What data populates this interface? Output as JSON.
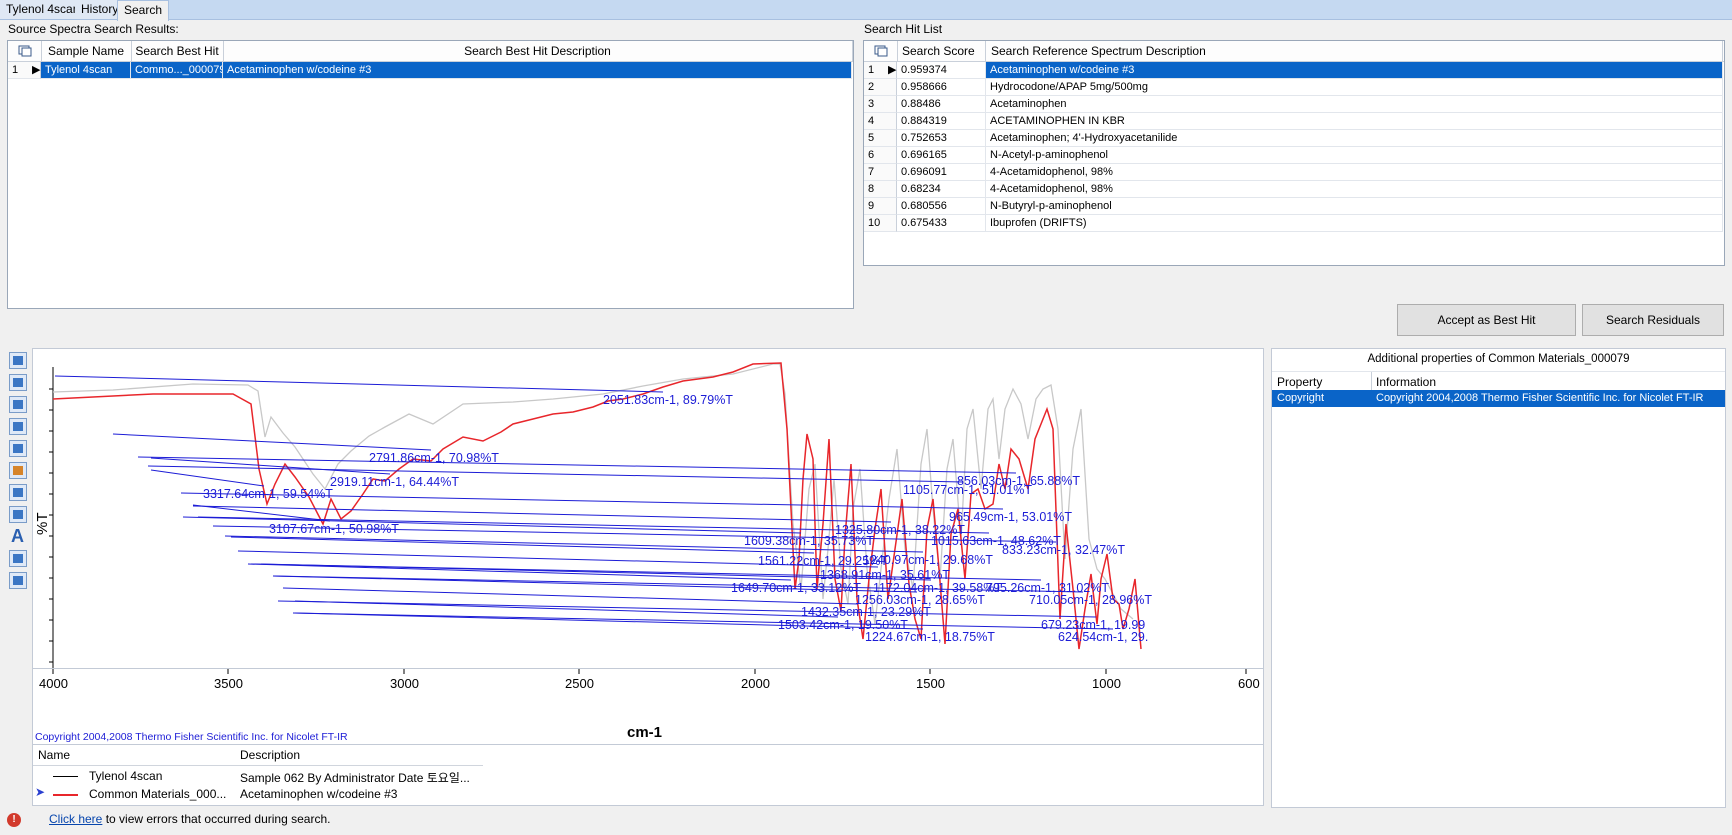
{
  "tabs": [
    "Tylenol 4scan",
    "History",
    "Search"
  ],
  "source_panel": {
    "label": "Source Spectra Search Results:",
    "columns": [
      "Sample Name",
      "Search Best Hit",
      "Search Best Hit Description"
    ],
    "rows": [
      {
        "num": "1",
        "name": "Tylenol 4scan",
        "hit": "Commo..._000079",
        "desc": "Acetaminophen w/codeine #3"
      }
    ]
  },
  "hit_panel": {
    "label": "Search Hit List",
    "columns": [
      "Search Score",
      "Search Reference Spectrum Description"
    ],
    "rows": [
      {
        "num": "1",
        "score": "0.959374",
        "desc": "Acetaminophen w/codeine #3"
      },
      {
        "num": "2",
        "score": "0.958666",
        "desc": "Hydrocodone/APAP 5mg/500mg"
      },
      {
        "num": "3",
        "score": "0.88486",
        "desc": "Acetaminophen"
      },
      {
        "num": "4",
        "score": "0.884319",
        "desc": "ACETAMINOPHEN IN KBR"
      },
      {
        "num": "5",
        "score": "0.752653",
        "desc": "Acetaminophen; 4'-Hydroxyacetanilide"
      },
      {
        "num": "6",
        "score": "0.696165",
        "desc": "N-Acetyl-p-aminophenol"
      },
      {
        "num": "7",
        "score": "0.696091",
        "desc": "4-Acetamidophenol, 98%"
      },
      {
        "num": "8",
        "score": "0.68234",
        "desc": "4-Acetamidophenol, 98%"
      },
      {
        "num": "9",
        "score": "0.680556",
        "desc": "N-Butyryl-p-aminophenol"
      },
      {
        "num": "10",
        "score": "0.675433",
        "desc": "Ibuprofen (DRIFTS)"
      }
    ],
    "buttons": {
      "accept": "Accept as Best Hit",
      "residuals": "Search Residuals"
    }
  },
  "properties_panel": {
    "title": "Additional properties of Common Materials_000079",
    "columns": [
      "Property",
      "Information"
    ],
    "rows": [
      {
        "prop": "Copyright",
        "info": "Copyright 2004,2008 Thermo Fisher Scientific Inc. for Nicolet FT-IR"
      }
    ]
  },
  "spectrum": {
    "ylabel": "%T",
    "xlabel": "cm-1",
    "copyright": "Copyright 2004,2008 Thermo Fisher Scientific Inc. for Nicolet FT-IR",
    "xticks": [
      "4000",
      "3500",
      "3000",
      "2500",
      "2000",
      "1500",
      "1000",
      "600"
    ],
    "series_colors": {
      "sample": "#c8c8c8",
      "reference": "#e8262b",
      "labels": "#1c1cd6"
    },
    "peak_labels": [
      "2051.83cm-1, 89.79%T",
      "2791.86cm-1, 70.98%T",
      "2919.11cm-1, 64.44%T",
      "3317.64cm-1, 59.54%T",
      "3107.67cm-1, 50.98%T",
      "1105.77cm-1, 51.01%T",
      "856.03cm-1, 65.88%T",
      "965.49cm-1, 53.01%T",
      "1325.80cm-1, 38.22%T",
      "1015.63cm-1, 48.62%T",
      "1609.38cm-1, 35.73%T",
      "833.23cm-1, 32.47%T",
      "1561.22cm-1, 29.25%T",
      "1240.97cm-1, 29.68%T",
      "1368.91cm-1, 35.61%T",
      "1172.04cm-1, 39.58%T",
      "795.26cm-1, 31.02%T",
      "1649.70cm-1, 33.12%T",
      "1256.03cm-1, 28.65%T",
      "710.05cm-1, 28.96%T",
      "1432.35cm-1, 23.29%T",
      "1503.42cm-1, 19.50%T",
      "679.23cm-1, 19.99",
      "1224.67cm-1, 18.75%T",
      "624.54cm-1, 29."
    ]
  },
  "legend": {
    "columns": [
      "Name",
      "Description"
    ],
    "rows": [
      {
        "name": "Tylenol 4scan",
        "desc": "Sample 062 By Administrator Date 토요일..."
      },
      {
        "name": "Common Materials_000...",
        "desc": "Acetaminophen w/codeine #3"
      }
    ]
  },
  "status": {
    "link": "Click here",
    "text": " to view errors that occurred during search."
  }
}
